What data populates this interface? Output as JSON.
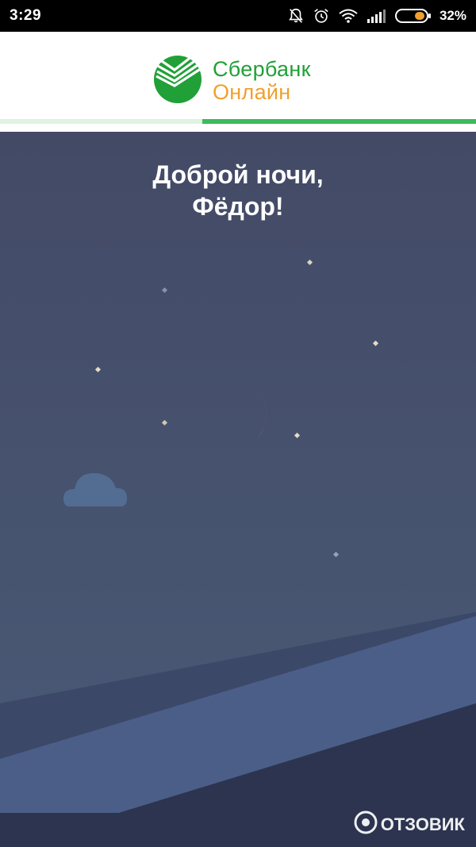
{
  "status_bar": {
    "time": "3:29",
    "battery_percent": "32%",
    "icons": [
      "bell-off-icon",
      "alarm-icon",
      "wifi-icon",
      "signal-icon",
      "battery-icon"
    ],
    "battery_color": "#f0a030"
  },
  "header": {
    "logo_line1": "Сбербанк",
    "logo_line2": "Онлайн",
    "brand_green": "#21a038",
    "brand_orange": "#f0a030",
    "progress": 0.575
  },
  "scene": {
    "greeting_line1": "Доброй ночи,",
    "greeting_line2": "Фёдор!",
    "moon_color": "#f5c531",
    "icons": [
      "moon-icon",
      "star-icon",
      "cloud-icon",
      "mountain-shape"
    ]
  },
  "watermark": {
    "text": "ОТЗОВИК"
  }
}
